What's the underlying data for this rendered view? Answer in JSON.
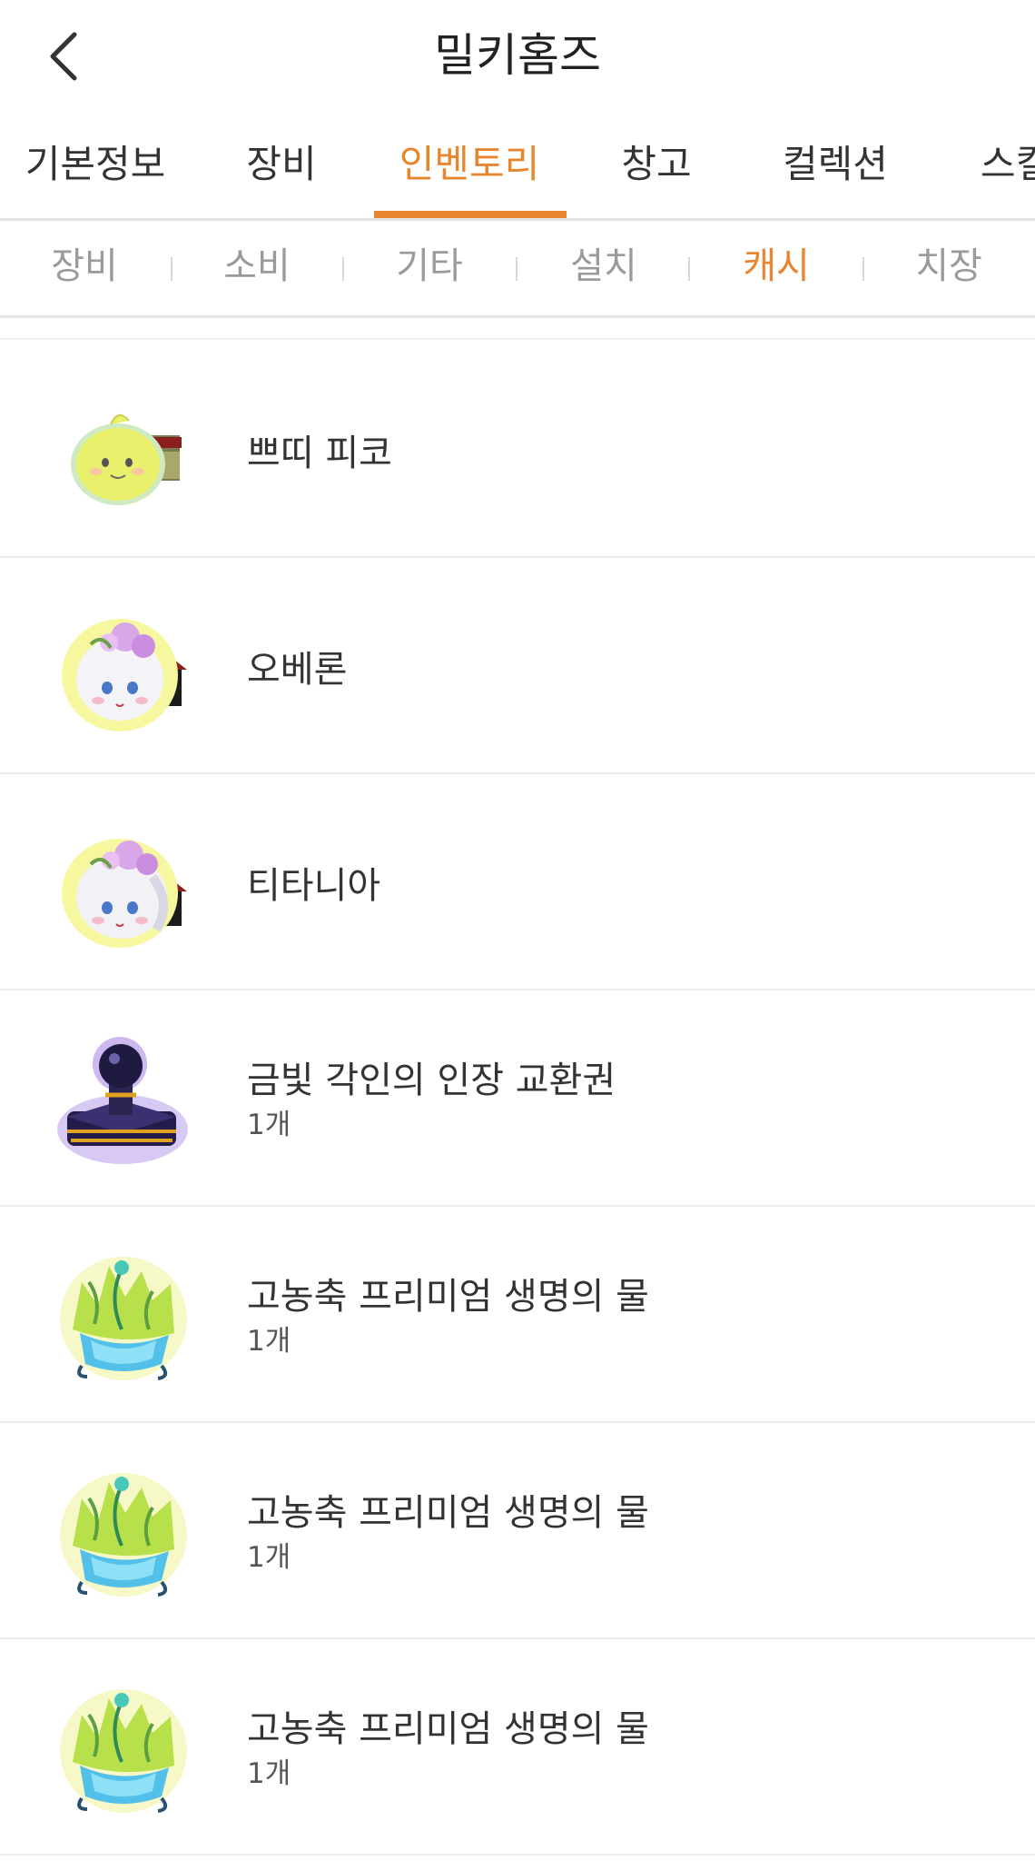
{
  "header": {
    "title": "밀키홈즈"
  },
  "tabs": [
    {
      "label": "기본정보"
    },
    {
      "label": "장비"
    },
    {
      "label": "인벤토리"
    },
    {
      "label": "창고"
    },
    {
      "label": "컬렉션"
    },
    {
      "label": "스킬"
    }
  ],
  "active_tab": "인벤토리",
  "subtabs": [
    {
      "label": "장비"
    },
    {
      "label": "소비"
    },
    {
      "label": "기타"
    },
    {
      "label": "설치"
    },
    {
      "label": "캐시"
    },
    {
      "label": "치장"
    }
  ],
  "active_subtab": "캐시",
  "items": [
    {
      "name": "쁘띠 피코",
      "count": "",
      "icon": "pico-pet-icon"
    },
    {
      "name": "오베론",
      "count": "",
      "icon": "oberon-pet-icon"
    },
    {
      "name": "티타니아",
      "count": "",
      "icon": "titania-pet-icon"
    },
    {
      "name": "금빛 각인의 인장 교환권",
      "count": "1개",
      "icon": "golden-seal-icon"
    },
    {
      "name": "고농축 프리미엄 생명의 물",
      "count": "1개",
      "icon": "water-of-life-icon"
    },
    {
      "name": "고농축 프리미엄 생명의 물",
      "count": "1개",
      "icon": "water-of-life-icon"
    },
    {
      "name": "고농축 프리미엄 생명의 물",
      "count": "1개",
      "icon": "water-of-life-icon"
    }
  ],
  "colors": {
    "accent": "#e8852f",
    "text": "#333333",
    "muted": "#9a9a9a"
  }
}
